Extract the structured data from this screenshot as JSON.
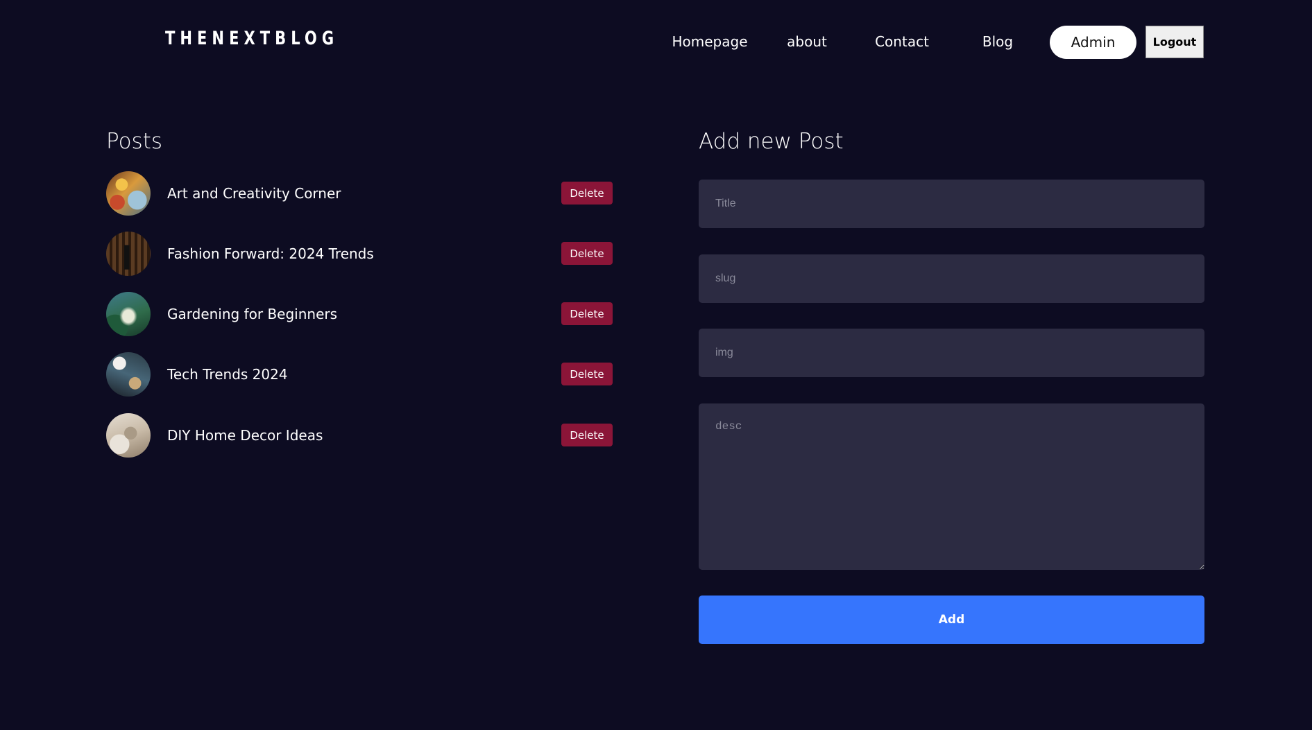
{
  "header": {
    "logo": "THENEXTBLOG",
    "nav": {
      "homepage": "Homepage",
      "about": "about",
      "contact": "Contact",
      "blog": "Blog"
    },
    "admin_label": "Admin",
    "logout_label": "Logout"
  },
  "posts": {
    "title": "Posts",
    "delete_label": "Delete",
    "items": [
      {
        "title": "Art and Creativity Corner"
      },
      {
        "title": "Fashion Forward: 2024 Trends"
      },
      {
        "title": "Gardening for Beginners"
      },
      {
        "title": "Tech Trends 2024"
      },
      {
        "title": "DIY Home Decor Ideas"
      }
    ]
  },
  "form": {
    "title": "Add new Post",
    "title_placeholder": "Title",
    "slug_placeholder": "slug",
    "img_placeholder": "img",
    "desc_placeholder": "desc",
    "submit_label": "Add"
  },
  "colors": {
    "background": "#0d0c22",
    "input_bg": "#2c2b42",
    "delete": "#8b1538",
    "primary": "#3675fd"
  }
}
